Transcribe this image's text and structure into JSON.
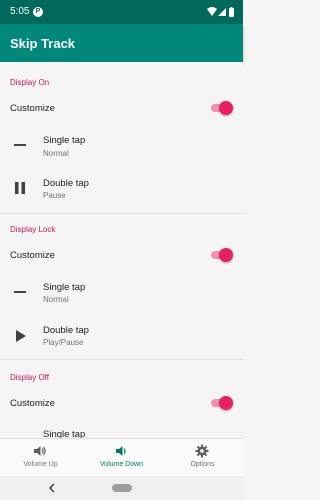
{
  "status_bar": {
    "time": "5:05",
    "app_icon_letter": "P",
    "icons": [
      "wifi-icon",
      "signal-icon",
      "battery-icon"
    ]
  },
  "app_bar": {
    "title": "Skip Track"
  },
  "sections": [
    {
      "header": "Display On",
      "customize_label": "Customize",
      "customize_enabled": true,
      "actions": [
        {
          "title": "Single tap",
          "subtitle": "Normal",
          "icon": "minus-icon"
        },
        {
          "title": "Double tap",
          "subtitle": "Pause",
          "icon": "pause-icon"
        }
      ]
    },
    {
      "header": "Display Lock",
      "customize_label": "Customize",
      "customize_enabled": true,
      "actions": [
        {
          "title": "Single tap",
          "subtitle": "Normal",
          "icon": "minus-icon"
        },
        {
          "title": "Double tap",
          "subtitle": "Play/Pause",
          "icon": "play-icon"
        }
      ]
    },
    {
      "header": "Display Off",
      "customize_label": "Customize",
      "customize_enabled": true,
      "actions": [
        {
          "title": "Single tap",
          "subtitle": "",
          "icon": "minus-icon"
        }
      ]
    }
  ],
  "bottom_nav": {
    "items": [
      {
        "label": "Volume Up",
        "icon": "volume-up-icon",
        "active": false
      },
      {
        "label": "Volume Down",
        "icon": "volume-down-icon",
        "active": true
      },
      {
        "label": "Options",
        "icon": "gear-icon",
        "active": false
      }
    ]
  },
  "colors": {
    "status_bar": "#00695c",
    "app_bar": "#00897b",
    "accent": "#e91e63",
    "section_header": "#c2185b",
    "nav_active": "#00796b"
  }
}
